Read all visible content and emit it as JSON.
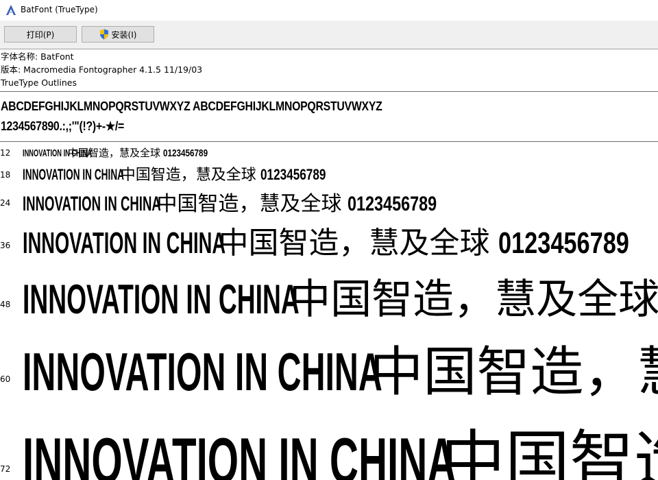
{
  "window": {
    "title": "BatFont (TrueType)",
    "icon": "font-icon"
  },
  "toolbar": {
    "print_label": "打印(P)",
    "install_label": "安装(I)"
  },
  "font_info": {
    "name_line": "字体名称: BatFont",
    "version_line": "版本: Macromedia Fontographer 4.1.5 11/19/03",
    "outline_line": "TrueType Outlines"
  },
  "charset": {
    "line1": "ABCDEFGHIJKLMNOPQRSTUVWXYZ ABCDEFGHIJKLMNOPQRSTUVWXYZ",
    "line2": "1234567890.:,;'\"(!?)+-★/="
  },
  "samples": {
    "latin": "INNOVATION IN CHINA",
    "cjk": "中国智造，慧及全球",
    "digits": "0123456789",
    "sizes": [
      "12",
      "18",
      "24",
      "36",
      "48",
      "60",
      "72"
    ]
  }
}
